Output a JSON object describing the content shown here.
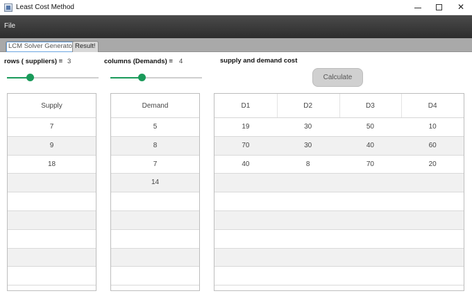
{
  "window": {
    "title": "Least Cost Method",
    "minimize_label": "",
    "close_label": "✕"
  },
  "menu": {
    "file_label": "File"
  },
  "tabs": [
    {
      "label": "LCM Solver Generator",
      "active": true
    },
    {
      "label": "Result!",
      "active": false
    }
  ],
  "controls": {
    "rows_label": "rows ( suppliers) =",
    "rows_value": "3",
    "rows_slider_fraction": 0.25,
    "columns_label": "columns (Demands) =",
    "columns_value": "4",
    "columns_slider_fraction": 0.34,
    "cost_label": "supply and demand cost",
    "calculate_label": "Calculate",
    "accent_color": "#1a9a5a"
  },
  "supply_table": {
    "header": "Supply",
    "values": [
      "7",
      "9",
      "18",
      "",
      "",
      "",
      "",
      "",
      ""
    ]
  },
  "demand_table": {
    "header": "Demand",
    "values": [
      "5",
      "8",
      "7",
      "14",
      "",
      "",
      "",
      "",
      ""
    ]
  },
  "cost_table": {
    "headers": [
      "D1",
      "D2",
      "D3",
      "D4"
    ],
    "rows": [
      [
        "19",
        "30",
        "50",
        "10"
      ],
      [
        "70",
        "30",
        "40",
        "60"
      ],
      [
        "40",
        "8",
        "70",
        "20"
      ],
      [
        "",
        "",
        "",
        ""
      ],
      [
        "",
        "",
        "",
        ""
      ],
      [
        "",
        "",
        "",
        ""
      ],
      [
        "",
        "",
        "",
        ""
      ],
      [
        "",
        "",
        "",
        ""
      ],
      [
        "",
        "",
        "",
        ""
      ]
    ]
  }
}
